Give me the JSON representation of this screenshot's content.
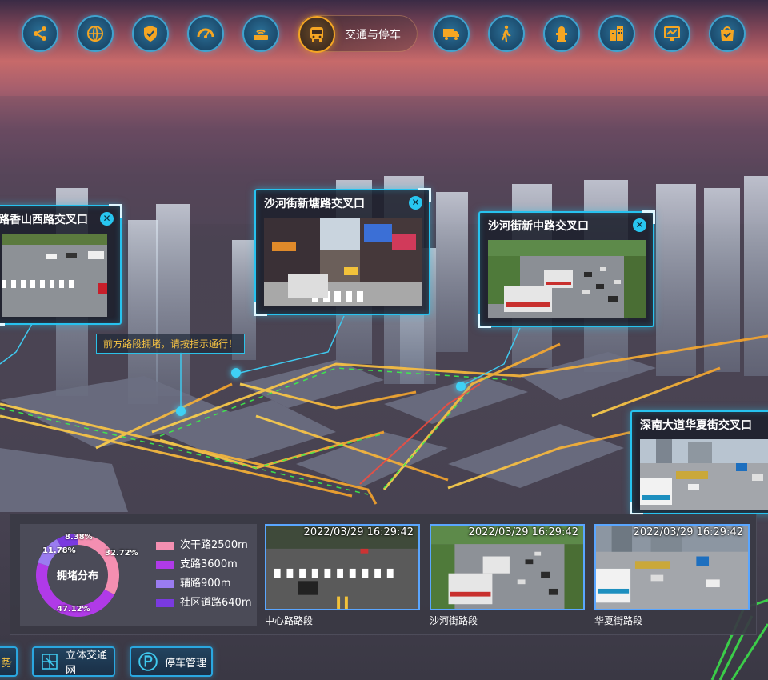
{
  "nav": {
    "items": [
      {
        "icon": "share-icon"
      },
      {
        "icon": "globe-icon"
      },
      {
        "icon": "shield-icon"
      },
      {
        "icon": "dashboard-icon"
      },
      {
        "icon": "router-icon"
      },
      {
        "icon": "bus-icon",
        "label": "交通与停车",
        "active": true
      },
      {
        "icon": "truck-icon"
      },
      {
        "icon": "pedestrian-icon"
      },
      {
        "icon": "hydrant-icon"
      },
      {
        "icon": "building-icon"
      },
      {
        "icon": "monitor-chart-icon"
      },
      {
        "icon": "shopping-bag-icon"
      }
    ]
  },
  "cameras": [
    {
      "title": "路香山西路交叉口"
    },
    {
      "title": "沙河街新塘路交叉口"
    },
    {
      "title": "沙河街新中路交叉口"
    },
    {
      "title": "深南大道华夏街交叉口"
    }
  ],
  "alert": {
    "text": "前方路段拥堵，请按指示通行！"
  },
  "congestion": {
    "center_label": "拥堵分布",
    "legend": [
      {
        "label": "次干路2500m",
        "color": "#f48fb1"
      },
      {
        "label": "支路3600m",
        "color": "#b03ae8"
      },
      {
        "label": "辅路900m",
        "color": "#9a7cf0"
      },
      {
        "label": "社区道路640m",
        "color": "#7a3ae0"
      }
    ]
  },
  "chart_data": {
    "type": "pie",
    "title": "拥堵分布",
    "categories": [
      "次干路",
      "支路",
      "辅路",
      "社区道路"
    ],
    "values": [
      32.72,
      47.12,
      11.78,
      8.38
    ],
    "value_labels": [
      "32.72%",
      "47.12%",
      "11.78%",
      "8.38%"
    ],
    "colors": [
      "#f48fb1",
      "#b03ae8",
      "#9a7cf0",
      "#7a3ae0"
    ]
  },
  "feeds": [
    {
      "timestamp": "2022/03/29 16:29:42",
      "caption": "中心路路段"
    },
    {
      "timestamp": "2022/03/29 16:29:42",
      "caption": "沙河街路段"
    },
    {
      "timestamp": "2022/03/29 16:29:42",
      "caption": "华夏街路段"
    }
  ],
  "bottom_buttons": [
    {
      "label": "势",
      "icon": "trend-icon"
    },
    {
      "label": "立体交通网",
      "icon": "network-icon"
    },
    {
      "label": "停车管理",
      "icon": "parking-icon"
    }
  ]
}
